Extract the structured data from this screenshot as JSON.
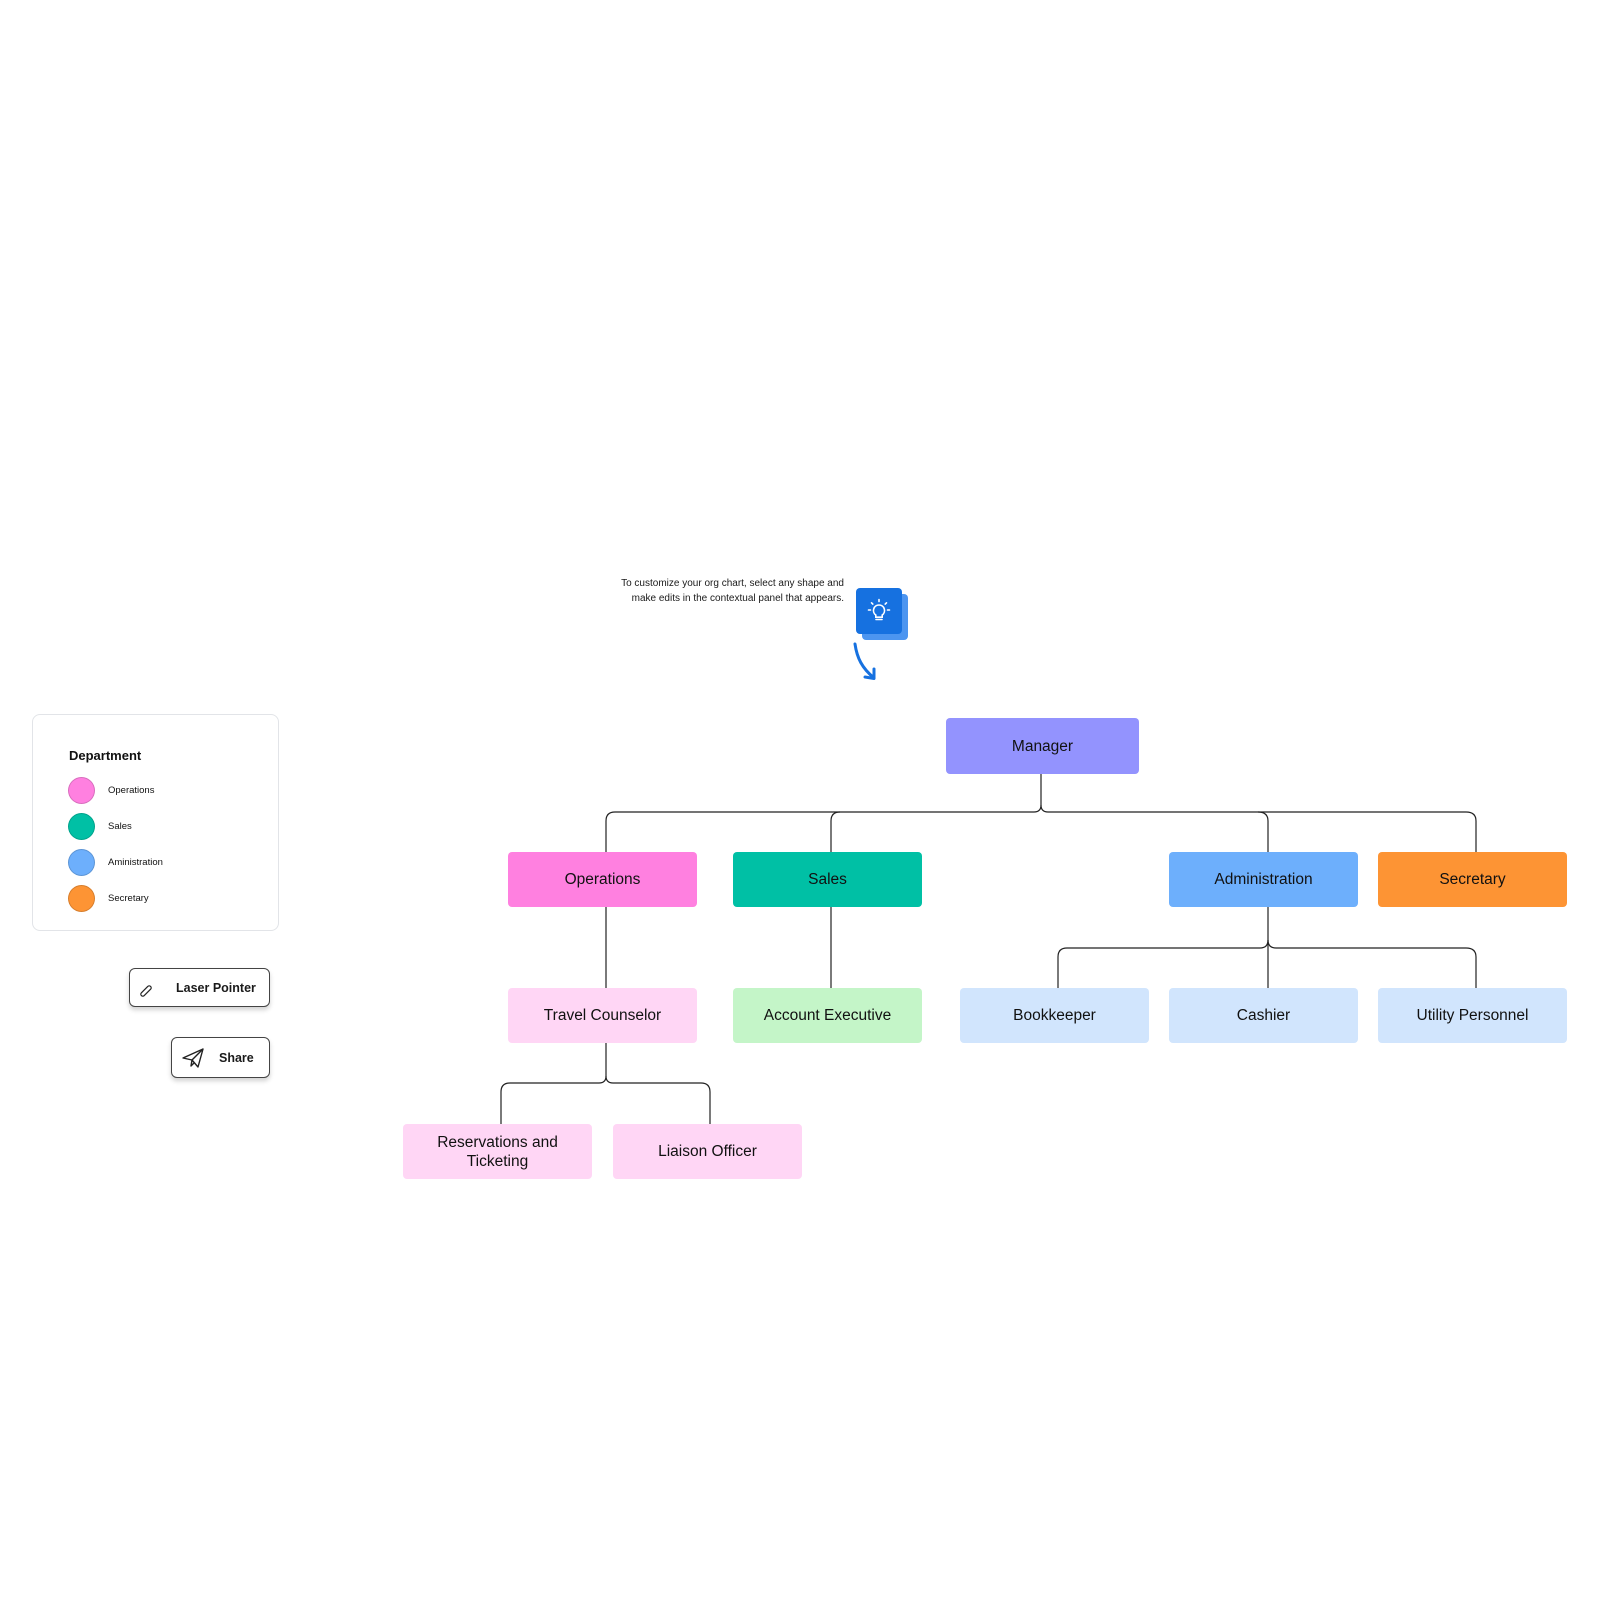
{
  "tip": {
    "text": "To customize your org chart, select any shape and make edits in the contextual panel that appears.",
    "icon": "lightbulb-icon",
    "accent": "#1671e0"
  },
  "legend": {
    "title": "Department",
    "items": [
      {
        "label": "Operations",
        "color": "#ff80e0"
      },
      {
        "label": "Sales",
        "color": "#00c0a5"
      },
      {
        "label": "Aministration",
        "color": "#6daffc"
      },
      {
        "label": "Secretary",
        "color": "#fd9434"
      }
    ]
  },
  "toolbar": {
    "laser_pointer_label": "Laser Pointer",
    "laser_pointer_icon": "laser-pointer-icon",
    "share_label": "Share",
    "share_icon": "paper-plane-icon"
  },
  "org_chart": {
    "nodes": [
      {
        "id": "manager",
        "label": "Manager",
        "color": "#9393fe",
        "parent": null
      },
      {
        "id": "operations",
        "label": "Operations",
        "color": "#ff80e0",
        "parent": "manager"
      },
      {
        "id": "sales",
        "label": "Sales",
        "color": "#00c0a5",
        "parent": "manager"
      },
      {
        "id": "administration",
        "label": "Administration",
        "color": "#6daffc",
        "parent": "manager"
      },
      {
        "id": "secretary",
        "label": "Secretary",
        "color": "#fd9434",
        "parent": "manager"
      },
      {
        "id": "travel-counselor",
        "label": "Travel Counselor",
        "color": "#ffd6f5",
        "parent": "operations"
      },
      {
        "id": "account-executive",
        "label": "Account Executive",
        "color": "#c4f5c8",
        "parent": "sales"
      },
      {
        "id": "bookkeeper",
        "label": "Bookkeeper",
        "color": "#d1e5fd",
        "parent": "administration"
      },
      {
        "id": "cashier",
        "label": "Cashier",
        "color": "#d1e5fd",
        "parent": "administration"
      },
      {
        "id": "utility-personnel",
        "label": "Utility Personnel",
        "color": "#d1e5fd",
        "parent": "administration"
      },
      {
        "id": "reservations-ticketing",
        "label": "Reservations and Ticketing",
        "color": "#ffd6f5",
        "parent": "travel-counselor"
      },
      {
        "id": "liaison-officer",
        "label": "Liaison Officer",
        "color": "#ffd6f5",
        "parent": "travel-counselor"
      }
    ]
  }
}
